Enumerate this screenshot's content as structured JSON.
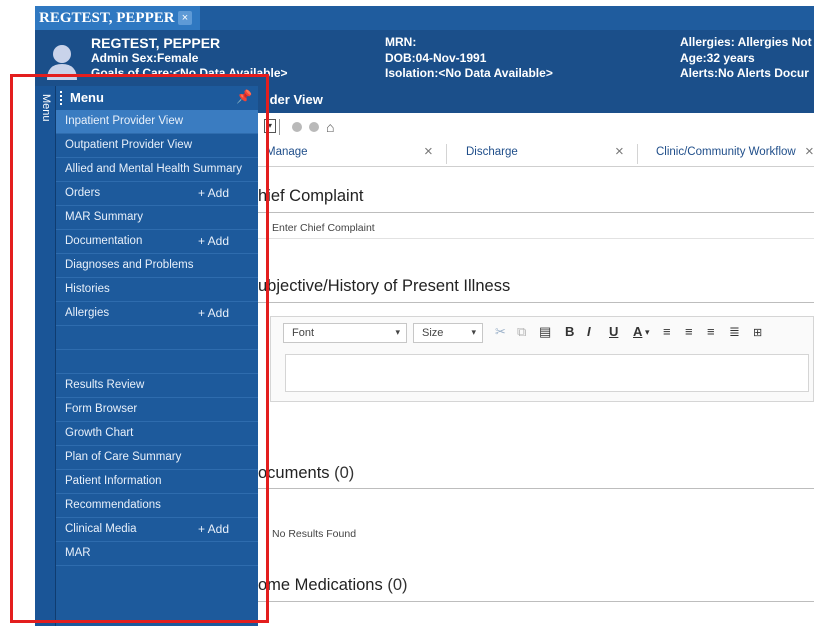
{
  "patient_tab": {
    "name": "REGTEST, PEPPER",
    "close": "×"
  },
  "banner": {
    "name": "REGTEST, PEPPER",
    "sex": "Admin Sex:Female",
    "goals": "Goals of Care:<No Data Available>",
    "mrn": "MRN:",
    "dob": "DOB:04-Nov-1991",
    "isolation": "Isolation:<No Data Available>",
    "allergies": "Allergies: Allergies Not",
    "age": "Age:32 years",
    "alerts": "Alerts:No Alerts Docur"
  },
  "vertical_tab": "Menu",
  "menu": {
    "title": "Menu",
    "pin": "📌",
    "add_label": "+ Add",
    "items": [
      {
        "label": "Inpatient Provider View",
        "active": true
      },
      {
        "label": "Outpatient Provider View"
      },
      {
        "label": "Allied and Mental Health Summary"
      },
      {
        "label": "Orders",
        "add": true
      },
      {
        "label": "MAR Summary"
      },
      {
        "label": "Documentation",
        "add": true
      },
      {
        "label": "Diagnoses and Problems"
      },
      {
        "label": "Histories"
      },
      {
        "label": "Allergies",
        "add": true
      },
      {
        "label": ""
      },
      {
        "label": ""
      },
      {
        "label": "Results Review"
      },
      {
        "label": "Form Browser"
      },
      {
        "label": "Growth Chart"
      },
      {
        "label": "Plan of Care Summary"
      },
      {
        "label": "Patient Information"
      },
      {
        "label": "Recommendations"
      },
      {
        "label": "Clinical Media",
        "add": true
      },
      {
        "label": "MAR"
      }
    ]
  },
  "view_title": "ider View",
  "tabs": [
    {
      "label": "Manage",
      "close": "×"
    },
    {
      "label": "Discharge",
      "close": "×"
    },
    {
      "label": "Clinic/Community Workflow",
      "close": "×"
    }
  ],
  "sections": {
    "chief_complaint": "hief Complaint",
    "chief_placeholder": "Enter Chief Complaint",
    "hpi": "ubjective/History of Present Illness",
    "documents": "ocuments",
    "documents_count": "(0)",
    "no_results": "No Results Found",
    "home_meds": "ome Medications",
    "home_meds_count": "(0)"
  },
  "editor": {
    "font": "Font",
    "size": "Size",
    "bold": "B",
    "italic": "I",
    "underline": "U",
    "font_color": "A"
  },
  "colors": {
    "accent": "#1d5a9c",
    "highlight": "#e31e1e"
  }
}
